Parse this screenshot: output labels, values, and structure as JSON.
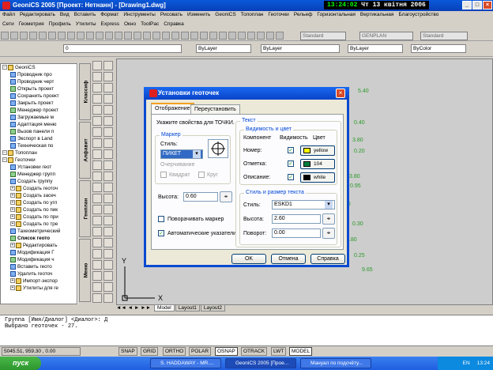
{
  "window": {
    "title": "GeoniCS 2005 [Проект: Нетнанн] - [Drawing1.dwg]",
    "clock": "13:24:02",
    "date": "Чт 13 квітня 2006"
  },
  "menu": [
    "Файл",
    "Редактировать",
    "Вид",
    "Вставить",
    "Формат",
    "Инструменты",
    "Рисовать",
    "Изменить",
    "GeoniCS",
    "Топоплан",
    "Геоточки",
    "Рельеф",
    "Горизонтальная",
    "Вертикальная",
    "Благоустройство"
  ],
  "menu2": [
    "Сети",
    "Геометрия",
    "Профиль",
    "Утилиты",
    "Express",
    "Окно",
    "ToolPac",
    "Справка"
  ],
  "toolbar": {
    "style1": "Standard",
    "genplan": "GENPLAN",
    "style2": "Standard",
    "layer": "0",
    "bylayer1": "ByLayer",
    "bylayer2": "ByLayer",
    "bylayer3": "ByLayer",
    "bycolor": "ByColor"
  },
  "tree": [
    {
      "t": "GeoniCS",
      "lvl": 0,
      "icon": "folder-icon"
    },
    {
      "t": "Проводник про",
      "lvl": 1,
      "icon": "explorer-icon"
    },
    {
      "t": "Проводник черт",
      "lvl": 1,
      "icon": "explorer-icon"
    },
    {
      "t": "Открыть проект",
      "lvl": 1,
      "icon": "open-icon"
    },
    {
      "t": "Сохранить проект",
      "lvl": 1,
      "icon": "save-icon"
    },
    {
      "t": "Закрыть проект",
      "lvl": 1,
      "icon": "close-icon"
    },
    {
      "t": "Менеджер проект",
      "lvl": 1,
      "icon": "manager-icon"
    },
    {
      "t": "Загружаемые м",
      "lvl": 1,
      "icon": "load-icon"
    },
    {
      "t": "Адаптация меню",
      "lvl": 1,
      "icon": "menu-icon"
    },
    {
      "t": "Вызов панели п",
      "lvl": 1,
      "icon": "panel-icon"
    },
    {
      "t": "Экспорт в Land",
      "lvl": 1,
      "icon": "export-icon"
    },
    {
      "t": "Техническая по",
      "lvl": 1,
      "icon": "help-icon"
    },
    {
      "t": "Топоплан",
      "lvl": 0,
      "icon": "folder-icon"
    },
    {
      "t": "Геоточки",
      "lvl": 0,
      "icon": "folder-icon"
    },
    {
      "t": "Установки геот",
      "lvl": 1,
      "icon": "settings-icon"
    },
    {
      "t": "Менеджер групп",
      "lvl": 1,
      "icon": "manager-icon"
    },
    {
      "t": "Создать группу",
      "lvl": 1,
      "icon": "group-icon"
    },
    {
      "t": "Создать геоточ",
      "lvl": 1,
      "icon": "folder-icon"
    },
    {
      "t": "Создать засеч",
      "lvl": 1,
      "icon": "folder-icon"
    },
    {
      "t": "Создать по угл",
      "lvl": 1,
      "icon": "folder-icon"
    },
    {
      "t": "Создать по пик",
      "lvl": 1,
      "icon": "folder-icon"
    },
    {
      "t": "Создать по при",
      "lvl": 1,
      "icon": "folder-icon"
    },
    {
      "t": "Создать по тре",
      "lvl": 1,
      "icon": "folder-icon"
    },
    {
      "t": "Тахеометрический",
      "lvl": 1,
      "icon": "tacheo-icon"
    },
    {
      "t": "Список геото",
      "lvl": 1,
      "icon": "list-icon",
      "bold": true
    },
    {
      "t": "Редактировать",
      "lvl": 1,
      "icon": "folder-icon"
    },
    {
      "t": "Модификация Г",
      "lvl": 1,
      "icon": "modify-icon"
    },
    {
      "t": "Модификация ч",
      "lvl": 1,
      "icon": "modify-icon"
    },
    {
      "t": "Вставить геото",
      "lvl": 1,
      "icon": "insert-icon"
    },
    {
      "t": "Удалить геоточ",
      "lvl": 1,
      "icon": "delete-icon"
    },
    {
      "t": "Импорт-экспор",
      "lvl": 1,
      "icon": "folder-icon"
    },
    {
      "t": "Утилиты для ге",
      "lvl": 1,
      "icon": "folder-icon"
    }
  ],
  "vtabs": [
    "Классиф",
    "Алфавит",
    "Генплан",
    "Меню"
  ],
  "canvas": {
    "labels": [
      "5.40",
      "0.40",
      "3.80",
      "0.20",
      "3.80",
      "0.95",
      "0.80",
      "0.30",
      "0.80",
      "0.25",
      "9.65"
    ]
  },
  "layout_tabs": [
    "Model",
    "Layout1",
    "Layout2"
  ],
  "axis": {
    "x": "X",
    "y": "Y"
  },
  "command": [
    "Группа [Имя/Диалог] <Диалог>: Д",
    "Выбрано геоточек - 27."
  ],
  "status": {
    "coords": "5045.51, 959.30 , 0.00",
    "buttons": [
      "SNAP",
      "GRID",
      "ORTHO",
      "POLAR",
      "OSNAP",
      "OTRACK",
      "LWT",
      "MODEL"
    ]
  },
  "taskbar": {
    "start": "пуск",
    "tasks": [
      "S. HADDAWAY - MR....",
      "GeoniCS 2005 [Прое...",
      "Мануал по подсчёту..."
    ],
    "lang": "EN",
    "time": "13:24"
  },
  "dialog": {
    "title": "Установки геоточек",
    "tabs": [
      "Отображение",
      "Переустановить"
    ],
    "hint": "Укажите свойства для ТОЧКИ.",
    "marker_group": "Маркер",
    "style_label": "Стиль:",
    "style_value": "ПИКЕТ",
    "outline_group": "Очерчивание",
    "square": "Квадрат",
    "circle": "Круг",
    "height_label": "Высота:",
    "height_value": "0.60",
    "rotate_marker": "Поворачивать маркер",
    "auto_pointers": "Автоматические указатели",
    "text_group": "Текст",
    "vis_group": "Видимость и цвет",
    "col_component": "Компонент",
    "col_visibility": "Видимость",
    "col_color": "Цвет",
    "rows": [
      {
        "name": "Номер:",
        "color": "yellow",
        "hex": "#ffff00"
      },
      {
        "name": "Отметка:",
        "color": "104",
        "hex": "#007f3f"
      },
      {
        "name": "Описание:",
        "color": "white",
        "hex": "#000000"
      }
    ],
    "size_group": "Стиль и размер текста",
    "text_style_label": "Стиль:",
    "text_style_value": "ESKD1",
    "text_height_label": "Высота:",
    "text_height_value": "2.60",
    "rotation_label": "Поворот:",
    "rotation_value": "0.00",
    "ok": "OK",
    "cancel": "Отмена",
    "help": "Справка"
  }
}
